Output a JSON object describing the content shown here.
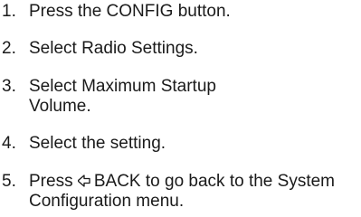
{
  "steps": [
    {
      "number": "1.",
      "text": "Press the CONFIG button."
    },
    {
      "number": "2.",
      "text": "Select Radio Settings."
    },
    {
      "number": "3.",
      "text": "Select Maximum Startup Volume."
    },
    {
      "number": "4.",
      "text": "Select the setting."
    },
    {
      "number": "5.",
      "icon": "back-arrow-icon",
      "pre": "Press",
      "text": "BACK to go back to the System Configuration menu."
    }
  ]
}
